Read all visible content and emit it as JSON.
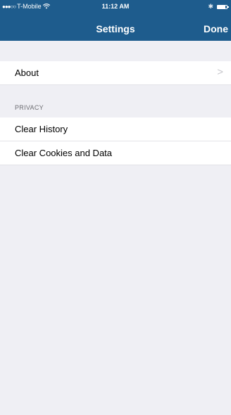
{
  "status_bar": {
    "carrier": "T-Mobile",
    "time": "11:12 AM",
    "battery_level": 0.85
  },
  "nav": {
    "title": "Settings",
    "done_label": "Done"
  },
  "sections": {
    "general": {
      "items": [
        {
          "label": "About"
        }
      ]
    },
    "privacy": {
      "header": "PRIVACY",
      "items": [
        {
          "label": "Clear History"
        },
        {
          "label": "Clear Cookies and Data"
        }
      ]
    }
  },
  "colors": {
    "nav_bar": "#1e5c8d",
    "background": "#efeff4",
    "cell": "#ffffff",
    "section_header_text": "#6d6d72",
    "chevron": "#c7c7cc"
  }
}
